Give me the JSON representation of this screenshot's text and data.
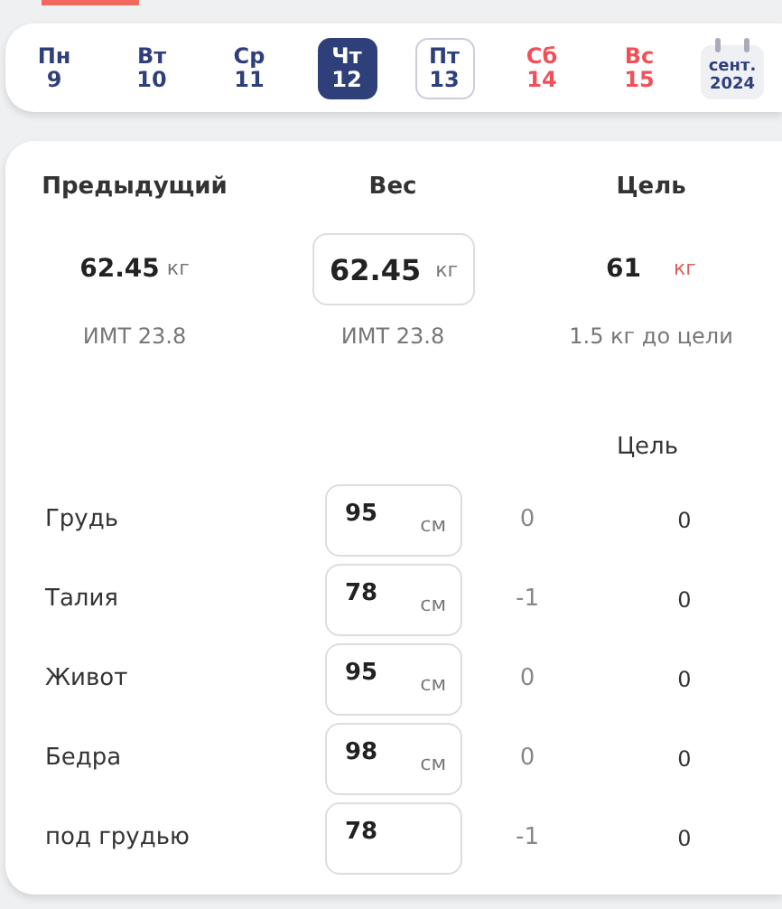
{
  "week": {
    "days": [
      {
        "weekday": "Пн",
        "date": "9",
        "selected": false,
        "today": false,
        "weekend": false
      },
      {
        "weekday": "Вт",
        "date": "10",
        "selected": false,
        "today": false,
        "weekend": false
      },
      {
        "weekday": "Ср",
        "date": "11",
        "selected": false,
        "today": false,
        "weekend": false
      },
      {
        "weekday": "Чт",
        "date": "12",
        "selected": true,
        "today": false,
        "weekend": false
      },
      {
        "weekday": "Пт",
        "date": "13",
        "selected": false,
        "today": true,
        "weekend": false
      },
      {
        "weekday": "Сб",
        "date": "14",
        "selected": false,
        "today": false,
        "weekend": true
      },
      {
        "weekday": "Вс",
        "date": "15",
        "selected": false,
        "today": false,
        "weekend": true
      }
    ],
    "calendar": {
      "month": "сент.",
      "year": "2024"
    }
  },
  "weight": {
    "columns": [
      {
        "kind": "previous",
        "title": "Предыдущий",
        "value": "62.45",
        "unit": "кг",
        "note": "ИМТ 23.8"
      },
      {
        "kind": "input",
        "title": "Вес",
        "value": "62.45",
        "unit": "кг",
        "note": "ИМТ 23.8"
      },
      {
        "kind": "goal",
        "title": "Цель",
        "value": "61",
        "unit": "кг",
        "note": "1.5 кг до цели"
      }
    ]
  },
  "measurements": {
    "goal_header": "Цель",
    "rows": [
      {
        "label": "Грудь",
        "value": "95",
        "unit": "см",
        "change": "0",
        "goal": "0"
      },
      {
        "label": "Талия",
        "value": "78",
        "unit": "см",
        "change": "-1",
        "goal": "0"
      },
      {
        "label": "Живот",
        "value": "95",
        "unit": "см",
        "change": "0",
        "goal": "0"
      },
      {
        "label": "Бедра",
        "value": "98",
        "unit": "см",
        "change": "0",
        "goal": "0"
      },
      {
        "label": "под грудью",
        "value": "78",
        "change": "-1",
        "goal": "0"
      }
    ]
  }
}
